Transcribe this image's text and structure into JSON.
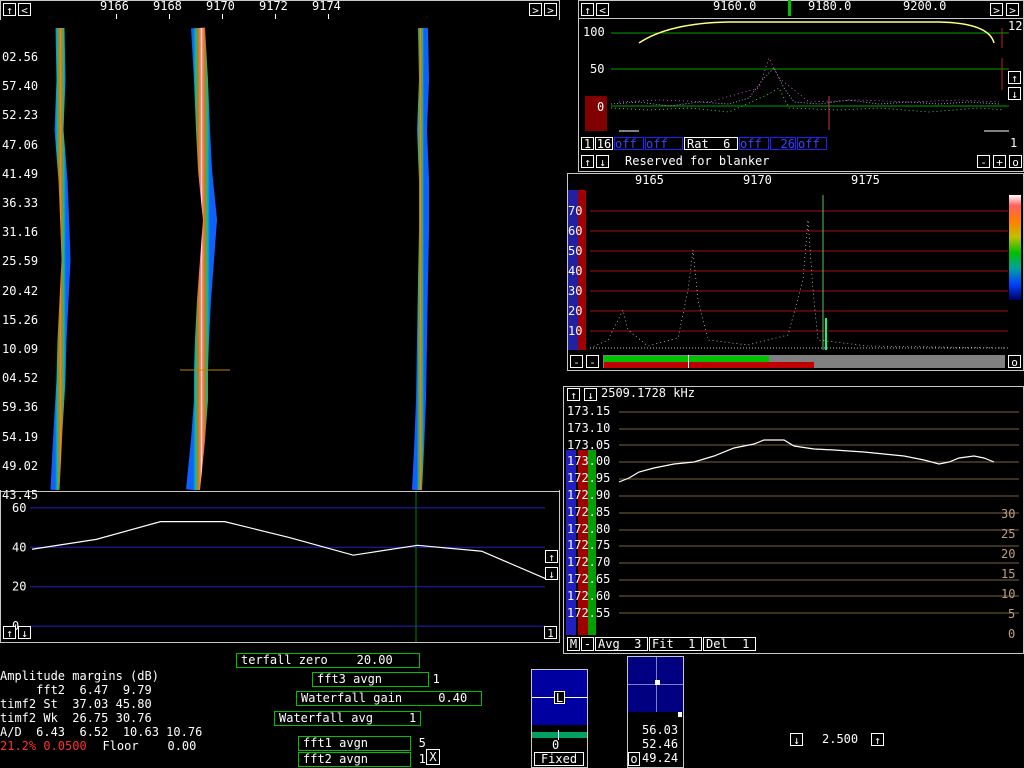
{
  "waterfall": {
    "freq_ticks": [
      "9166",
      "9168",
      "9170",
      "9172",
      "9174"
    ],
    "time_labels": [
      "02.56",
      "57.40",
      "52.23",
      "47.06",
      "41.49",
      "36.33",
      "31.16",
      "25.59",
      "20.42",
      "15.26",
      "10.09",
      "04.52",
      "59.36",
      "54.19",
      "49.02",
      "43.45"
    ],
    "spectrum_y_ticks": [
      "60",
      "40",
      "20",
      "0"
    ],
    "spectrum_chart": {
      "type": "line",
      "y": [
        39,
        44,
        53,
        53,
        45,
        36,
        41,
        38,
        24
      ],
      "ylim": [
        -6,
        66
      ]
    }
  },
  "fft1": {
    "freq_ticks": [
      "9160.0",
      "9180.0",
      "9200.0"
    ],
    "y_ticks": [
      "100",
      "50",
      "0"
    ],
    "right_label_top": "12",
    "right_label_bottom": "1",
    "controls": {
      "btn1": "1",
      "btn16": "16",
      "off1": "off",
      "off2": "off",
      "rat": "Rat  6",
      "off3": "off",
      "val26": "26",
      "off4": "off"
    },
    "blanker_label": "Reserved for blanker"
  },
  "fft2": {
    "freq_ticks": [
      "9165",
      "9170",
      "9175"
    ],
    "y_ticks": [
      "70",
      "60",
      "50",
      "40",
      "30",
      "20",
      "10"
    ]
  },
  "freq_graph": {
    "title": "2509.1728 kHz",
    "y_ticks": [
      "173.15",
      "173.10",
      "173.05",
      "173.00",
      "172.95",
      "172.90",
      "172.85",
      "172.80",
      "172.75",
      "172.70",
      "172.65",
      "172.60",
      "172.55"
    ],
    "right_ticks": [
      "30",
      "25",
      "20",
      "15",
      "10",
      "5",
      "0"
    ],
    "avg": "Avg  3",
    "fit": "Fit  1",
    "del": "Del  1",
    "btn_m": "M",
    "btn_minus": "-"
  },
  "parameters": {
    "waterfall_zero": "terfall zero    20.00",
    "fft3_avgn": "fft3 avgn       1",
    "waterfall_gain": "Waterfall gain     0.40",
    "waterfall_avg": "Waterfall avg     1",
    "fft1_avgn": "fft1 avgn       5",
    "fft2_avgn": "fft2 avgn       1",
    "close": "X"
  },
  "amplitude": {
    "title": "Amplitude margins (dB)",
    "rows": [
      "     fft2  6.47  9.79",
      "timf2 St  37.03 45.80",
      "timf2 Wk  26.75 30.76",
      "A/D  6.43  6.52  10.63 10.76"
    ],
    "status_red": "21.2% 0.0500",
    "floor": "  Floor    0.00"
  },
  "meters": {
    "s_meter_label": "L",
    "s_value": "0",
    "mode": "Fixed",
    "coherent_values": [
      "56.03",
      "52.46",
      "49.24"
    ],
    "coherent_btn": "o"
  },
  "bandwidth": {
    "value": "2.500"
  },
  "colors": {
    "grid_blue": "#2020c0",
    "grid_green": "#00a000",
    "grid_red": "#a00000",
    "trace_white": "#ffffff",
    "accent_green": "#00c000"
  }
}
